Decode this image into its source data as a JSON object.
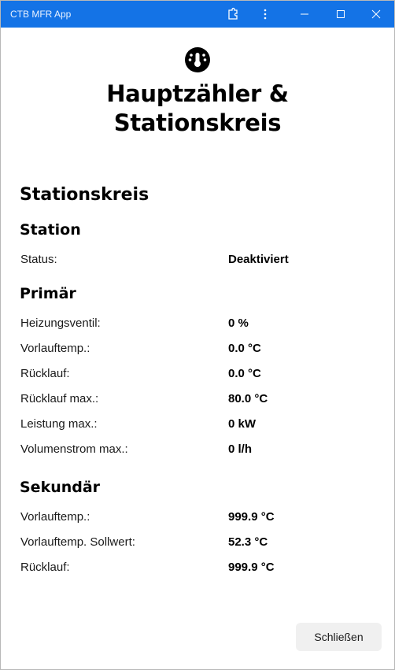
{
  "window": {
    "title": "CTB MFR App"
  },
  "header": {
    "icon": "thermometer-dial-icon",
    "title": "Hauptzähler & Stationskreis"
  },
  "section": {
    "title": "Stationskreis"
  },
  "station": {
    "title": "Station",
    "rows": [
      {
        "label": "Status:",
        "value": "Deaktiviert"
      }
    ]
  },
  "primaer": {
    "title": "Primär",
    "rows": [
      {
        "label": "Heizungsventil:",
        "value": "0 %"
      },
      {
        "label": "Vorlauftemp.:",
        "value": "0.0 °C"
      },
      {
        "label": "Rücklauf:",
        "value": "0.0 °C"
      },
      {
        "label": "Rücklauf max.:",
        "value": "80.0 °C"
      },
      {
        "label": "Leistung max.:",
        "value": "0 kW"
      },
      {
        "label": "Volumenstrom max.:",
        "value": "0 l/h"
      }
    ]
  },
  "sekundaer": {
    "title": "Sekundär",
    "rows": [
      {
        "label": "Vorlauftemp.:",
        "value": "999.9 °C"
      },
      {
        "label": "Vorlauftemp. Sollwert:",
        "value": "52.3 °C"
      },
      {
        "label": "Rücklauf:",
        "value": "999.9 °C"
      }
    ]
  },
  "footer": {
    "close_label": "Schließen"
  },
  "colors": {
    "titlebar": "#1473e6",
    "button_bg": "#f0f0f0"
  }
}
